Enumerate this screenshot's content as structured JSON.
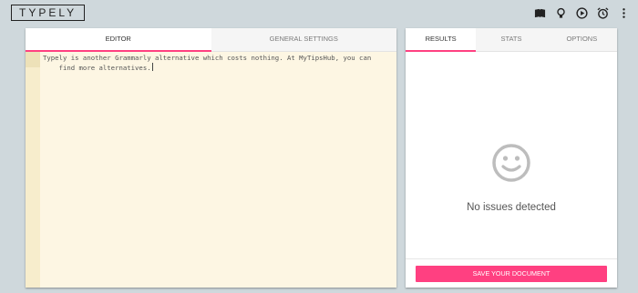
{
  "app": {
    "logo": "TYPELY"
  },
  "toolbar": {
    "icons": [
      "book-icon",
      "lightbulb-icon",
      "play-icon",
      "alarm-icon",
      "more-vert-icon"
    ]
  },
  "editor_panel": {
    "tabs": [
      {
        "label": "EDITOR",
        "active": true
      },
      {
        "label": "GENERAL SETTINGS",
        "active": false
      }
    ],
    "text_line1": "Typely is another Grammarly alternative which costs nothing. At MyTipsHub, you can",
    "text_line2": "    find more alternatives."
  },
  "results_panel": {
    "tabs": [
      {
        "label": "RESULTS",
        "active": true
      },
      {
        "label": "STATS",
        "active": false
      },
      {
        "label": "OPTIONS",
        "active": false
      }
    ],
    "status_icon": "smiley-icon",
    "status_text": "No issues detected",
    "save_button": "SAVE YOUR DOCUMENT"
  },
  "colors": {
    "accent": "#ff4081",
    "background": "#cfd8dc",
    "editor_bg": "#fdf6e3"
  }
}
